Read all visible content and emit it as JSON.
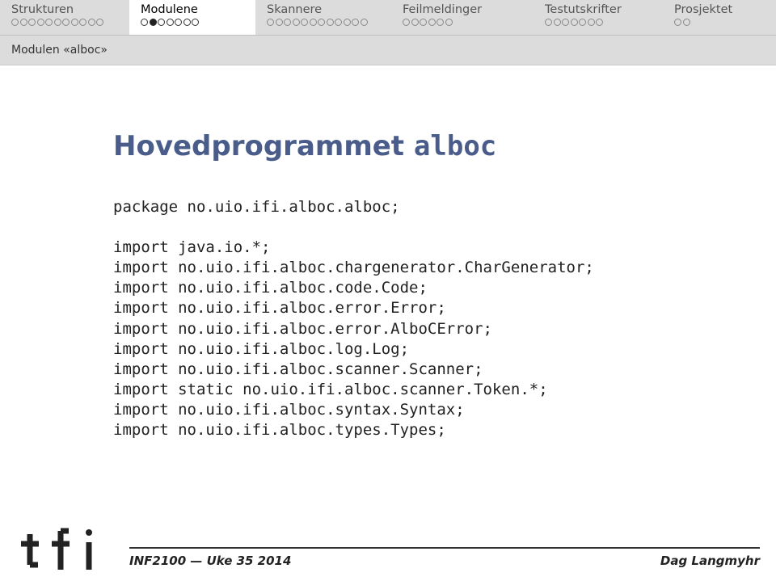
{
  "nav": {
    "tabs": [
      {
        "label": "Strukturen",
        "dots": 11,
        "filled": -1,
        "active": false
      },
      {
        "label": "Modulene",
        "dots": 7,
        "filled": 1,
        "active": true
      },
      {
        "label": "Skannere",
        "dots": 12,
        "filled": -1,
        "active": false
      },
      {
        "label": "Feilmeldinger",
        "dots": 6,
        "filled": -1,
        "active": false
      },
      {
        "label": "Testutskrifter",
        "dots": 7,
        "filled": -1,
        "active": false
      },
      {
        "label": "Prosjektet",
        "dots": 2,
        "filled": -1,
        "active": false
      }
    ]
  },
  "subheader": "Modulen «alboc»",
  "title_prefix": "Hovedprogrammet ",
  "title_mono": "alboc",
  "code": {
    "pkg": "package no.uio.ifi.alboc.alboc;",
    "l1": "import java.io.*;",
    "l2": "import no.uio.ifi.alboc.chargenerator.CharGenerator;",
    "l3": "import no.uio.ifi.alboc.code.Code;",
    "l4": "import no.uio.ifi.alboc.error.Error;",
    "l5": "import no.uio.ifi.alboc.error.AlboCError;",
    "l6": "import no.uio.ifi.alboc.log.Log;",
    "l7": "import no.uio.ifi.alboc.scanner.Scanner;",
    "l8": "import static no.uio.ifi.alboc.scanner.Token.*;",
    "l9": "import no.uio.ifi.alboc.syntax.Syntax;",
    "l10": "import no.uio.ifi.alboc.types.Types;"
  },
  "footer": {
    "left": "INF2100 — Uke 35 2014",
    "right": "Dag Langmyhr"
  }
}
